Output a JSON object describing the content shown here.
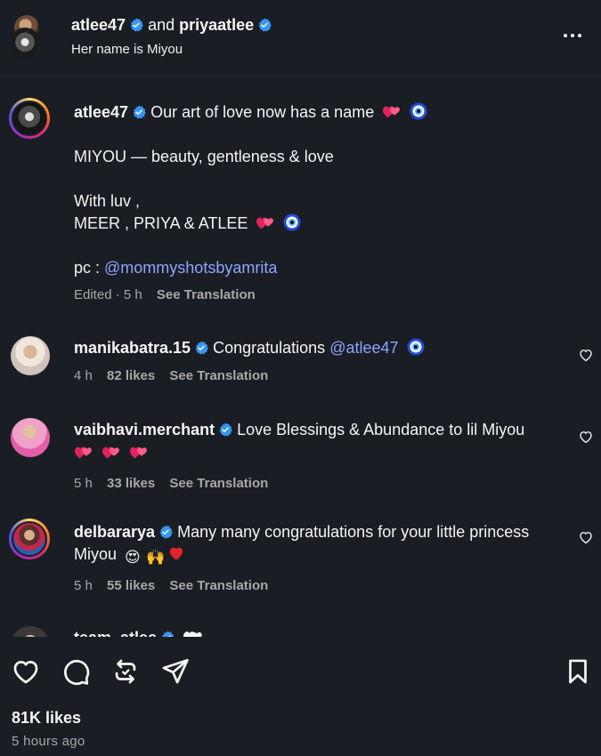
{
  "header": {
    "user1": "atlee47",
    "joiner": "and",
    "user2": "priyaatlee",
    "subtitle": "Her name is Miyou"
  },
  "caption": {
    "username": "atlee47",
    "line1": "Our art of love now has a name",
    "line2": "MIYOU — beauty, gentleness & love",
    "line3": "With luv ,",
    "line4": "MEER , PRIYA & ATLEE",
    "pc_label": "pc :",
    "pc_mention": "@mommyshotsbyamrita",
    "meta_edited": "Edited · 5 h",
    "meta_translate": "See Translation"
  },
  "comments": [
    {
      "username": "manikabatra.15",
      "text": "Congratulations",
      "mention": "@atlee47",
      "time": "4 h",
      "likes": "82 likes",
      "translate": "See Translation"
    },
    {
      "username": "vaibhavi.merchant",
      "text": "Love Blessings & Abundance to lil Miyou",
      "time": "5 h",
      "likes": "33 likes",
      "translate": "See Translation"
    },
    {
      "username": "delbararya",
      "text": "Many many congratulations for your little princess Miyou",
      "time": "5 h",
      "likes": "55 likes",
      "translate": "See Translation"
    },
    {
      "username": "team_atlee"
    }
  ],
  "footer": {
    "likes": "81K likes",
    "time_ago": "5 hours ago"
  },
  "icons": {
    "verified": "verified-badge-icon",
    "heart": "heart-icon",
    "comment": "comment-icon",
    "repost": "repost-icon",
    "share": "share-icon",
    "save": "bookmark-icon",
    "more": "more-icon"
  },
  "colors": {
    "background": "#1a1d24",
    "mention": "#8ea6ff",
    "verified": "#3797f0",
    "muted": "#a8a8a8"
  }
}
